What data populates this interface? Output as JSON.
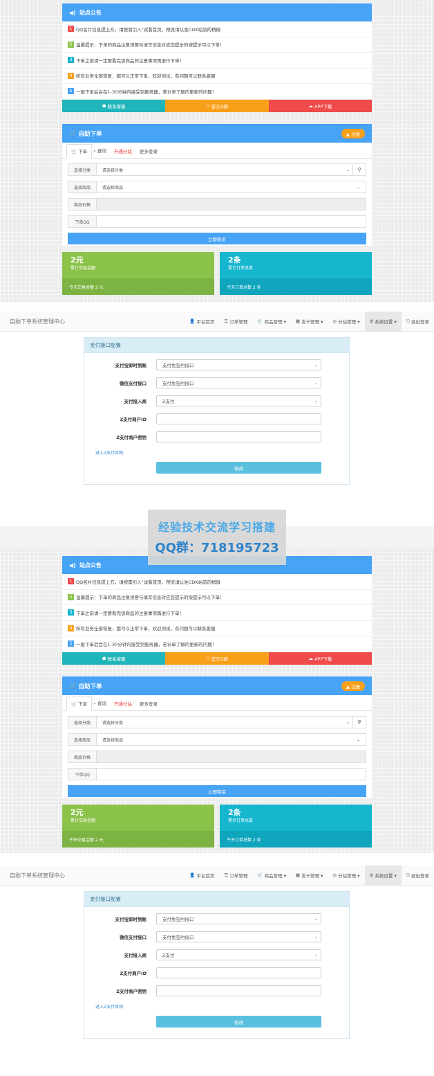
{
  "announcement": {
    "title": "站点公告",
    "items": [
      {
        "num": "1",
        "color": "#f04b4b",
        "text": "QQ名片信息提上方，请按需引入\"试看首页，预览请认准CDK站前的稍微"
      },
      {
        "num": "2",
        "color": "#8bc34a",
        "text": "温馨提示：下单的商品注意须要与填写信息对应您提示的按提示可以下单！"
      },
      {
        "num": "3",
        "color": "#17b6cf",
        "text": "下单之前请一定要看完该商品的注意事项再进行下单！"
      },
      {
        "num": "4",
        "color": "#f9a01b",
        "text": "所有业务全部恢复，都可以正常下单，欢迎测试，有问题可以联系客服"
      },
      {
        "num": "5",
        "color": "#47a3f5",
        "text": "一般下单后会在1-30分钟内接受到服务器，若计单了解的更新的问题！"
      }
    ],
    "buttons": {
      "contact": "联系客服",
      "qq": "官方Q群",
      "app": "APP下载"
    }
  },
  "order": {
    "title": "自助下单",
    "register_label": "注册",
    "tabs": [
      "下单",
      "查询",
      "开通分站",
      "更多登录"
    ],
    "category_label": "选择分类",
    "category_placeholder": "请选择分类",
    "goods_label": "选择商品",
    "goods_placeholder": "请选择商品",
    "price_label": "商品价格",
    "qq_label": "下单QQ",
    "buy_label": "立即购买"
  },
  "stats": {
    "amount_value": "2元",
    "amount_label": "累计交易金额",
    "amount_today": "今天交易金额 2 元",
    "orders_value": "2条",
    "orders_label": "累计订单总数",
    "orders_today": "今天订单总数 2 条"
  },
  "navbar": {
    "brand": "自助下单系统管理中心",
    "items": [
      {
        "icon": "👤",
        "label": "平台首页"
      },
      {
        "icon": "☰",
        "label": "订单管理"
      },
      {
        "icon": "🛒",
        "label": "商品管理 ▾"
      },
      {
        "icon": "▦",
        "label": "发卡管理 ▾"
      },
      {
        "icon": "◎",
        "label": "分站管理 ▾"
      },
      {
        "icon": "⚙",
        "label": "系统设置 ▾"
      },
      {
        "icon": "⎋",
        "label": "退出登录"
      }
    ]
  },
  "payment": {
    "title": "支付接口配置",
    "fields": [
      {
        "label": "支付宝即时到账",
        "value": "支付免签约接口"
      },
      {
        "label": "微信支付接口",
        "value": "支付免签约接口"
      },
      {
        "label": "支付接入商",
        "value": "Z支付"
      },
      {
        "label": "Z支付商户ID",
        "value": ""
      },
      {
        "label": "Z支付商户密钥",
        "value": ""
      }
    ],
    "link": "进入Z支付官网",
    "save_label": "修改"
  },
  "watermark": {
    "line1": "经验技术交流学习搭建",
    "line2": "QQ群：718195723"
  }
}
